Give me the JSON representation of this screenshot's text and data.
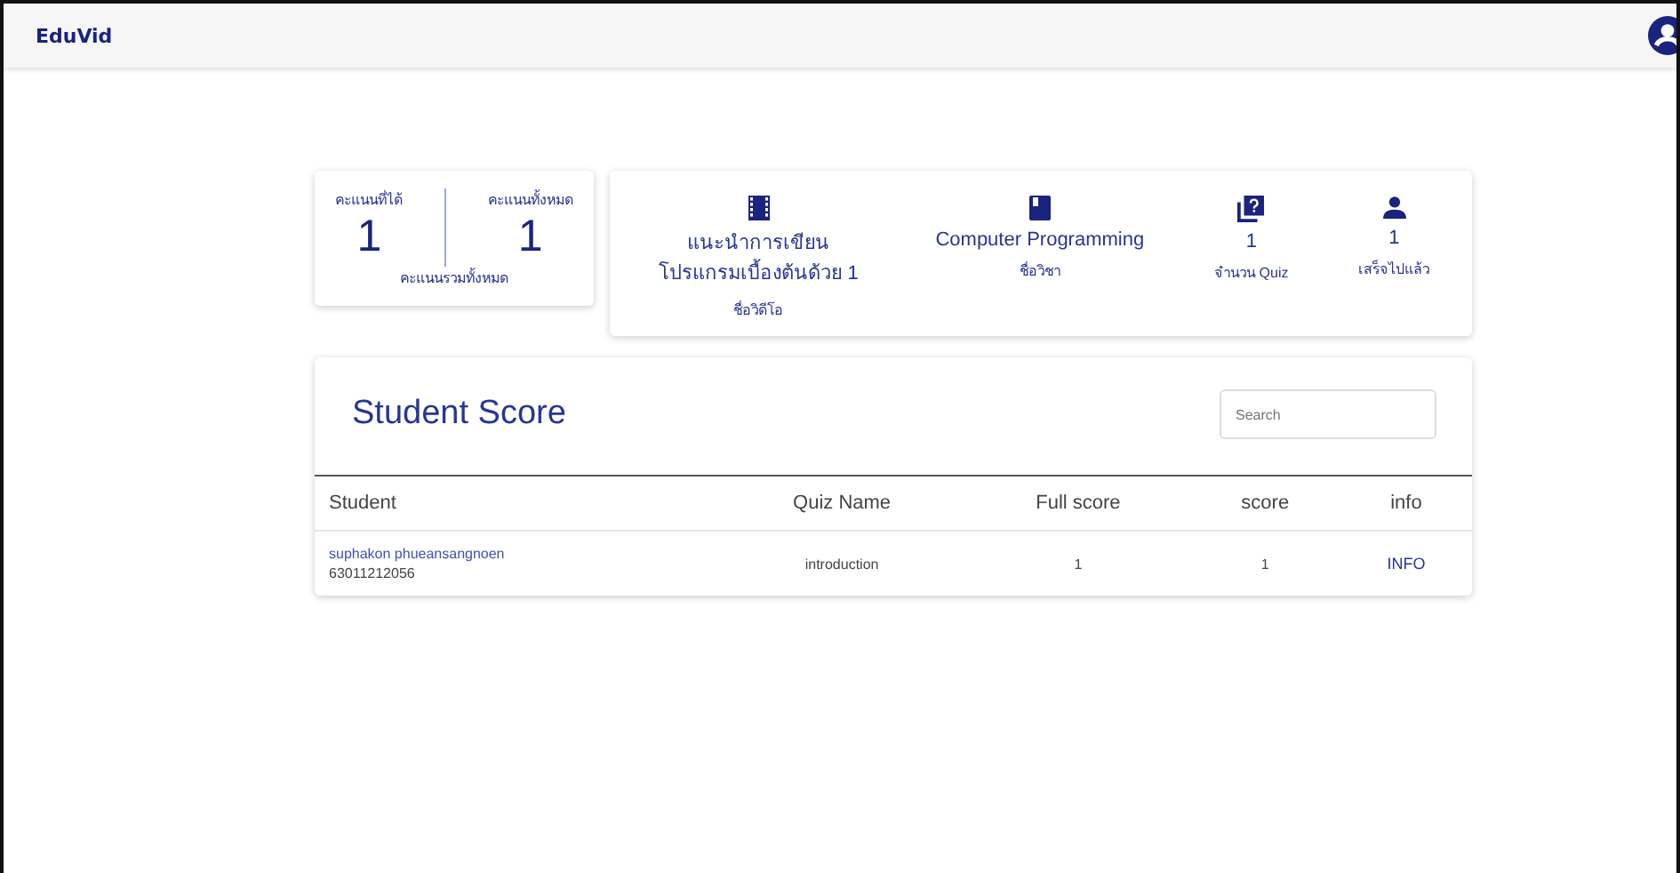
{
  "app_bar": {
    "title": "EduVid"
  },
  "score_summary": {
    "items": [
      {
        "label": "คะแนนที่ได้",
        "value": "1"
      },
      {
        "label": "คะแนนทั้งหมด",
        "value": "1"
      }
    ],
    "caption": "คะแนนรวมทั้งหมด"
  },
  "info_stats": [
    {
      "kind": "film",
      "value": "แนะนำการเขียนโปรแกรมเบื้องต้นด้วย 1",
      "label": "ชื่อวิดีโอ"
    },
    {
      "kind": "book",
      "value": "Computer Programming",
      "label": "ชื่อวิชา"
    },
    {
      "kind": "quiz",
      "value": "1",
      "label": "จำนวน Quiz"
    },
    {
      "kind": "person",
      "value": "1",
      "label": "เสร็จไปแล้ว"
    }
  ],
  "student_score": {
    "title": "Student Score",
    "search": {
      "placeholder": "Search"
    },
    "columns": [
      "Student",
      "Quiz Name",
      "Full score",
      "score",
      "info"
    ],
    "rows": [
      {
        "student_name": "suphakon phueansangnoen",
        "student_id": "63011212056",
        "quiz_name": "introduction",
        "full_score": "1",
        "score": "1",
        "info": "INFO"
      }
    ]
  }
}
